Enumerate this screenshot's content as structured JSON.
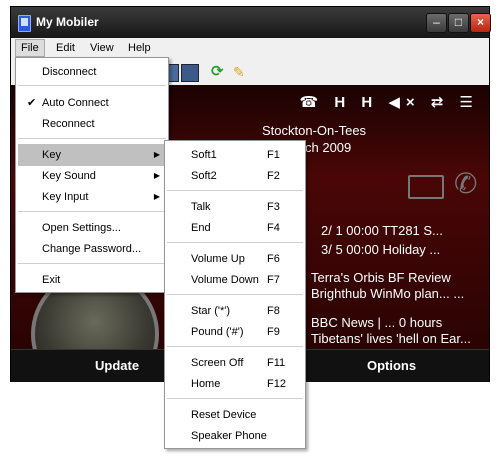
{
  "window": {
    "title": "My Mobiler"
  },
  "menubar": {
    "items": [
      "File",
      "Edit",
      "View",
      "Help"
    ]
  },
  "screen": {
    "status_icons": "☎ H H ◀× ⇄ ☰",
    "location": "Stockton-On-Tees",
    "date_partial": "ch 2009",
    "rows": [
      "2/ 1     00:00 TT281 S...",
      "3/ 5     00:00 Holiday ...",
      "Terra's Orbis BF Review",
      "Brighthub WinMo plan... ...",
      "BBC News | ...      0 hours",
      "Tibetans' lives 'hell on Ear..."
    ]
  },
  "softkeys": {
    "left": "Update",
    "right": "Options"
  },
  "file_menu": {
    "items": [
      {
        "label": "Disconnect"
      },
      {
        "label": "Auto Connect",
        "checked": true
      },
      {
        "label": "Reconnect"
      },
      {
        "label": "Key",
        "submenu": true,
        "highlighted": true
      },
      {
        "label": "Key Sound",
        "submenu": true
      },
      {
        "label": "Key Input",
        "submenu": true
      },
      {
        "label": "Open Settings..."
      },
      {
        "label": "Change Password..."
      },
      {
        "label": "Exit"
      }
    ]
  },
  "key_menu": {
    "items": [
      {
        "label": "Soft1",
        "key": "F1"
      },
      {
        "label": "Soft2",
        "key": "F2"
      },
      {
        "label": "Talk",
        "key": "F3"
      },
      {
        "label": "End",
        "key": "F4"
      },
      {
        "label": "Volume Up",
        "key": "F6"
      },
      {
        "label": "Volume Down",
        "key": "F7"
      },
      {
        "label": "Star ('*')",
        "key": "F8"
      },
      {
        "label": "Pound ('#')",
        "key": "F9"
      },
      {
        "label": "Screen Off",
        "key": "F11"
      },
      {
        "label": "Home",
        "key": "F12"
      },
      {
        "label": "Reset Device",
        "key": ""
      },
      {
        "label": "Speaker Phone",
        "key": ""
      }
    ]
  }
}
